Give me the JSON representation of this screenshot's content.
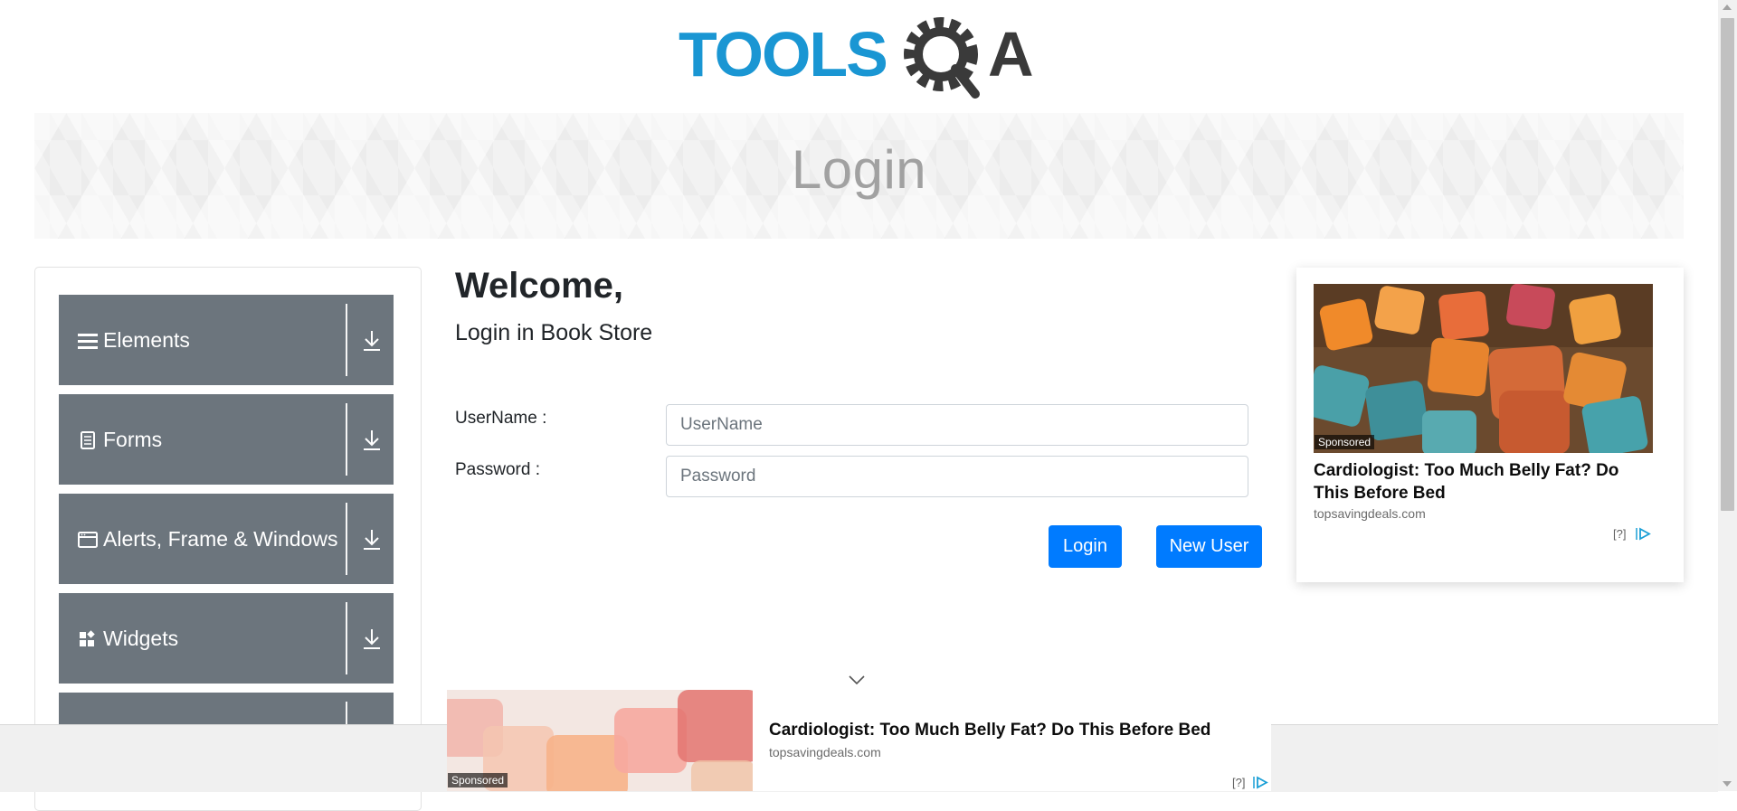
{
  "header": {
    "logo_text": "TOOLSQA",
    "logo_colors": {
      "tools": "#1a96d3",
      "qa": "#3a3a3a"
    }
  },
  "banner": {
    "title": "Login"
  },
  "sidebar": {
    "groups": [
      {
        "label": "Elements",
        "icon": "hamburger-icon"
      },
      {
        "label": "Forms",
        "icon": "document-icon"
      },
      {
        "label": "Alerts, Frame & Windows",
        "icon": "window-icon"
      },
      {
        "label": "Widgets",
        "icon": "widgets-icon"
      },
      {
        "label": "",
        "icon": ""
      }
    ],
    "colors": {
      "group_bg": "#6c757d",
      "text": "#ffffff"
    }
  },
  "main": {
    "welcome": "Welcome,",
    "subtitle": "Login in Book Store",
    "username_label": "UserName :",
    "username_placeholder": "UserName",
    "username_value": "",
    "password_label": "Password :",
    "password_placeholder": "Password",
    "password_value": "",
    "login_button": "Login",
    "new_user_button": "New User",
    "accent": "#007bff"
  },
  "ad_right": {
    "sponsored": "Sponsored",
    "headline": "Cardiologist: Too Much Belly Fat? Do This Before Bed",
    "domain": "topsavingdeals.com",
    "help": "[?]"
  },
  "ad_bottom": {
    "sponsored": "Sponsored",
    "headline": "Cardiologist: Too Much Belly Fat? Do This Before Bed",
    "domain": "topsavingdeals.com",
    "help": "[?]"
  }
}
